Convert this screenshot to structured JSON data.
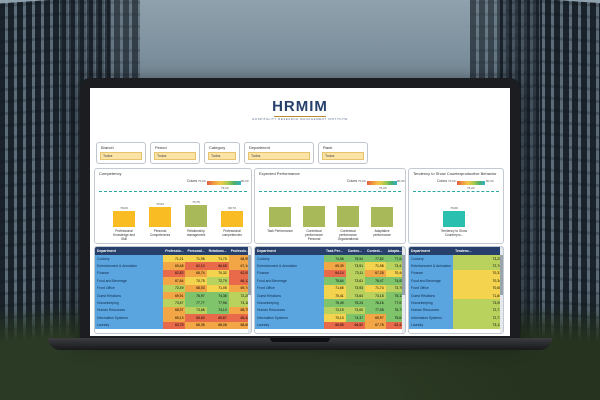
{
  "logo": {
    "word": "HRMIM",
    "sub": "HOSPITALITY RESEARCH MANAGEMENT INSTITUTE"
  },
  "filters": [
    {
      "label": "Branch",
      "value": "Todos"
    },
    {
      "label": "Period",
      "value": "Todos"
    },
    {
      "label": "Category",
      "value": "Todos"
    },
    {
      "label": "Department",
      "value": "Todos"
    },
    {
      "label": "Rank",
      "value": "Todos"
    }
  ],
  "colors_label": "Colors",
  "competency": {
    "title": "Competency",
    "scale_min": "70,00",
    "scale_max": "80,00",
    "target": "76,00",
    "bars": [
      {
        "label": "Professional Knowledge and Skill",
        "value": "70,03",
        "score": 70.03,
        "color": "#f9bd23"
      },
      {
        "label": "Personal Competencies",
        "value": "73,64",
        "score": 73.64,
        "color": "#f9bd23"
      },
      {
        "label": "Relationship management",
        "value": "74,75",
        "score": 74.75,
        "color": "#a8b95a"
      },
      {
        "label": "Professional competencies",
        "value": "69,73",
        "score": 69.73,
        "color": "#f9bd23"
      }
    ]
  },
  "expected": {
    "title": "Expected Performance",
    "scale_min": "70,00",
    "scale_max": "80,00",
    "target": "76,00",
    "bars": [
      {
        "label": "Task Performance",
        "value": "",
        "score": 73.2,
        "color": "#a8b95a"
      },
      {
        "label": "Contextual performance Personal",
        "value": "",
        "score": 74.0,
        "color": "#a8b95a"
      },
      {
        "label": "Contextual performance Organizational",
        "value": "",
        "score": 74.6,
        "color": "#a8b95a"
      },
      {
        "label": "Adaptative performance",
        "value": "",
        "score": 73.4,
        "color": "#a8b95a"
      }
    ]
  },
  "tendency": {
    "title": "Tendency to Show Counterproductive Behavior",
    "scale_min": "70,00",
    "scale_max": "80,00",
    "target": "76,00",
    "bars": [
      {
        "label": "Tendency to Show Counterpro...",
        "value": "70,00",
        "score": 70.0,
        "color": "#2bbfb0"
      }
    ]
  },
  "tables": {
    "competency": {
      "headers": [
        "Department",
        "Professio...",
        "Personal...",
        "Relations...",
        "Professio..."
      ],
      "rows": [
        [
          "Cookery",
          "71,21",
          "71,95",
          "71,70",
          "68,95"
        ],
        [
          "Entertainment & Animation",
          "69,48",
          "62,10",
          "66,68",
          "67,14"
        ],
        [
          "Finance",
          "62,82",
          "68,74",
          "70,32",
          "62,05"
        ],
        [
          "Food and Beverage",
          "67,64",
          "70,75",
          "72,79",
          "66,12"
        ],
        [
          "Front Office",
          "72,49",
          "68,03",
          "71,05",
          "69,74"
        ],
        [
          "Guest Relations",
          "69,91",
          "76,97",
          "74,36",
          "72,25"
        ],
        [
          "Housekeeping",
          "73,57",
          "77,77",
          "77,96",
          "73,18"
        ],
        [
          "Human Resources",
          "68,97",
          "73,68",
          "74,10",
          "68,79"
        ],
        [
          "Information Systems",
          "69,13",
          "65,63",
          "65,87",
          "65,42"
        ],
        [
          "Laundry",
          "63,75",
          "68,35",
          "68,08",
          "68,65"
        ]
      ]
    },
    "expected": {
      "headers": [
        "Department",
        "Task Per...",
        "Contex...",
        "Context...",
        "Adapta..."
      ],
      "rows": [
        [
          "Cookery",
          "74,58",
          "75,94",
          "77,82",
          "77,04"
        ],
        [
          "Entertainment & Animation",
          "69,39",
          "73,51",
          "71,98",
          "73,41"
        ],
        [
          "Finance",
          "64,14",
          "73,11",
          "67,28",
          "70,44"
        ],
        [
          "Food and Beverage",
          "75,64",
          "73,61",
          "76,47",
          "74,05"
        ],
        [
          "Front Office",
          "71,65",
          "73,93",
          "71,74",
          "73,76"
        ],
        [
          "Guest Relations",
          "70,41",
          "73,64",
          "73,18",
          "75,13"
        ],
        [
          "Housekeeping",
          "75,49",
          "75,24",
          "76,16",
          "77,01"
        ],
        [
          "Human Resources",
          "72,19",
          "73,00",
          "77,08",
          "76,77"
        ],
        [
          "Information Systems",
          "70,13",
          "74,37",
          "69,97",
          "75,61"
        ],
        [
          "Laundry",
          "66,85",
          "66,82",
          "67,78",
          "62,47"
        ]
      ]
    },
    "tendency": {
      "headers": [
        "Department",
        "Tendenc..."
      ],
      "rows": [
        [
          "Cookery",
          "73,25"
        ],
        [
          "Entertainment & Animation",
          "72,74"
        ],
        [
          "Finance",
          "70,31"
        ],
        [
          "Food and Beverage",
          "70,34"
        ],
        [
          "Front Office",
          "70,60"
        ],
        [
          "Guest Relations",
          "71,84"
        ],
        [
          "Housekeeping",
          "73,05"
        ],
        [
          "Human Resources",
          "72,71"
        ],
        [
          "Information Systems",
          "72,71"
        ],
        [
          "Laundry",
          "73,13"
        ]
      ]
    }
  }
}
